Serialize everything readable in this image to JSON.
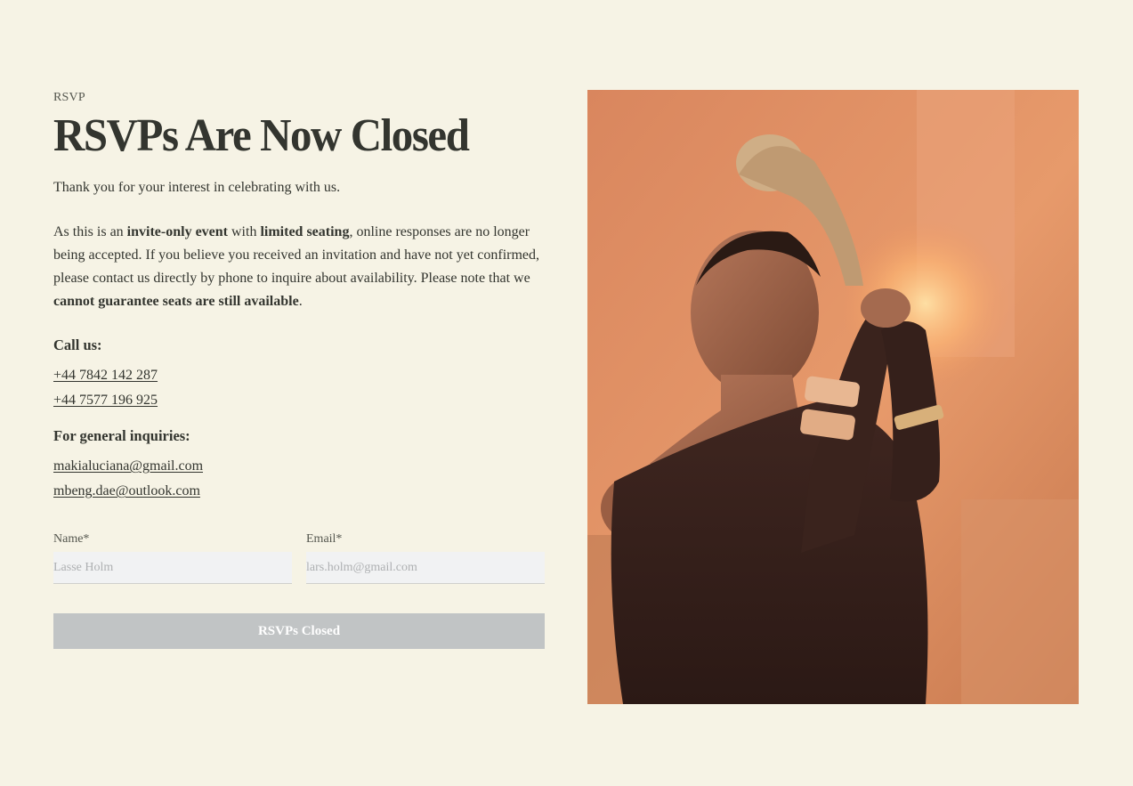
{
  "header": {
    "eyebrow": "RSVP",
    "title": "RSVPs Are Now Closed"
  },
  "content": {
    "lead": "Thank you for your interest in celebrating with us.",
    "paragraph": {
      "part1": "As this is an ",
      "bold1": "invite-only event",
      "part2": " with ",
      "bold2": "limited seating",
      "part3": ", online responses are no longer being accepted. If you believe you received an invitation and have not yet confirmed, please contact us directly by phone to inquire about availability. Please note that we ",
      "bold3": "cannot guarantee seats are still available",
      "part4": "."
    }
  },
  "contact": {
    "call_label": "Call us:",
    "phones": [
      "+44 7842 142 287",
      "+44 7577 196 925"
    ],
    "inquiries_label": "For general inquiries:",
    "emails": [
      "makialuciana@gmail.com",
      "mbeng.dae@outlook.com"
    ]
  },
  "form": {
    "name_label": "Name*",
    "name_placeholder": "Lasse Holm",
    "email_label": "Email*",
    "email_placeholder": "lars.holm@gmail.com",
    "submit_label": "RSVPs Closed"
  },
  "colors": {
    "background": "#f6f3e5",
    "text": "#33352f",
    "button_disabled": "#c1c4c5",
    "input_bg": "#f1f2f3"
  }
}
